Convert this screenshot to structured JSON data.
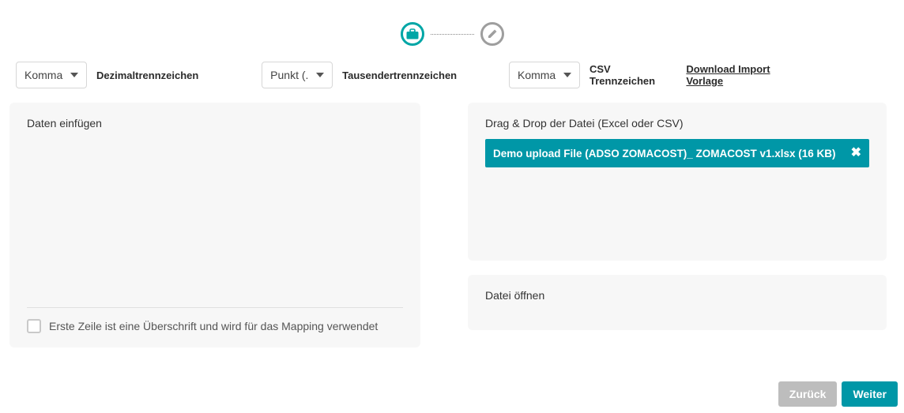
{
  "stepper": {
    "step1_icon": "briefcase-icon",
    "step2_icon": "pencil-icon"
  },
  "controls": {
    "decimal": {
      "value": "Komma",
      "label": "Dezimaltrennzeichen"
    },
    "thousand": {
      "value": "Punkt (.",
      "label": "Tausendertrennzeichen"
    },
    "csv": {
      "value": "Komma",
      "label": "CSV Trennzeichen"
    },
    "download_link": "Download Import Vorlage"
  },
  "left": {
    "title": "Daten einfügen",
    "checkbox_label": "Erste Zeile ist eine Überschrift und wird für das Mapping verwendet"
  },
  "right": {
    "drop_title": "Drag & Drop der Datei (Excel oder CSV)",
    "file_name": "Demo upload File (ADSO ZOMACOST)_ ZOMACOST v1.xlsx (16 KB)",
    "open_title": "Datei öffnen"
  },
  "footer": {
    "back": "Zurück",
    "next": "Weiter"
  }
}
